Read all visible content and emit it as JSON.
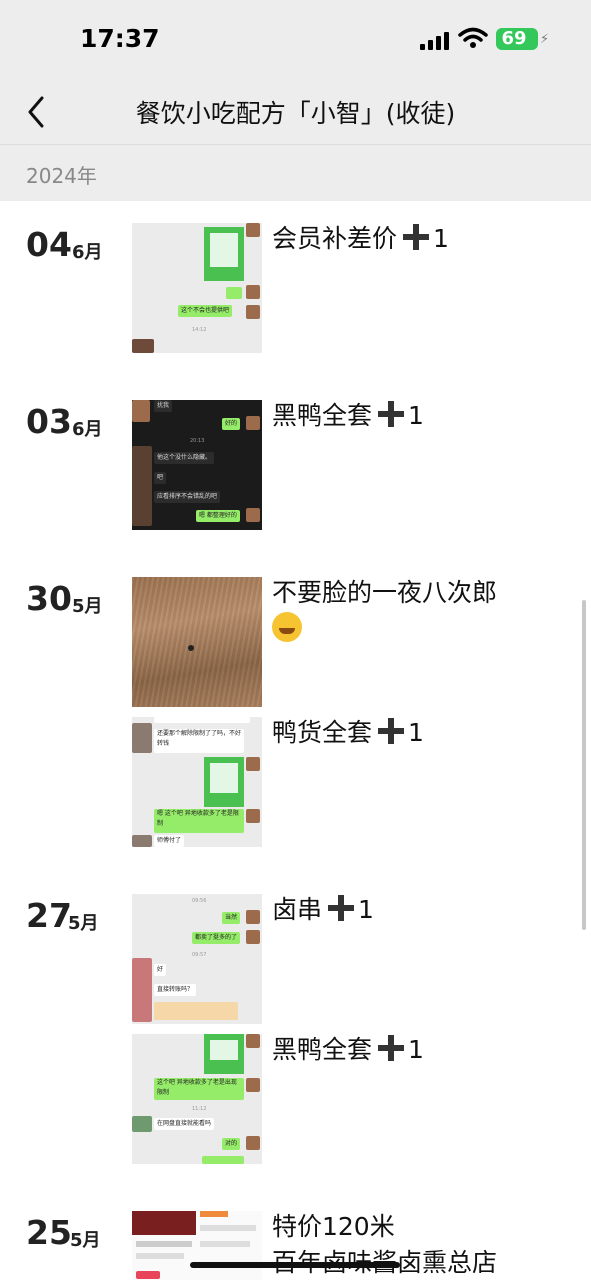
{
  "status": {
    "time": "17:37",
    "battery": "69"
  },
  "nav": {
    "title": "餐饮小吃配方「小智」(收徒)",
    "back_icon": "chevron-left-icon"
  },
  "year": "2024年",
  "days": [
    {
      "day": "04",
      "month": "6月",
      "posts": [
        {
          "text": "会员补差价",
          "plus": true,
          "count": "1",
          "thumb_text": [
            "这个不会也提供吧",
            "14:12"
          ]
        }
      ]
    },
    {
      "day": "03",
      "month": "6月",
      "posts": [
        {
          "text": "黑鸭全套",
          "plus": true,
          "count": "1",
          "thumb_text": [
            "扰我",
            "好的",
            "20:13",
            "他这个没什么隐藏。",
            "吧",
            "应看排序不会错乱的吧",
            "嗯 都整理好的"
          ]
        }
      ]
    },
    {
      "day": "30",
      "month": "5月",
      "posts": [
        {
          "text": "不要脸的一夜八次郎",
          "emoji": "crying-laughing-emoji"
        },
        {
          "text": "鸭货全套",
          "plus": true,
          "count": "1",
          "thumb_text": [
            "还要那个解除限制了了吗，不好转钱",
            "嗯 这个吧 异地收款多了老是限制",
            "师傅付了"
          ]
        }
      ]
    },
    {
      "day": "27",
      "month": "5月",
      "posts": [
        {
          "text": "卤串",
          "plus": true,
          "count": "1",
          "thumb_text": [
            "09:56",
            "当然",
            "都卖了挺多的了",
            "09:57",
            "好",
            "直接转账吗？"
          ]
        },
        {
          "text": "黑鸭全套",
          "plus": true,
          "count": "1",
          "thumb_text": [
            "这个吧 异地收款多了老是出现限制",
            "11:12",
            "在网盘直接就能看吗",
            "对的"
          ]
        }
      ]
    },
    {
      "day": "25",
      "month": "5月",
      "posts": [
        {
          "text": "特价120米",
          "line2": "百年卤味酱卤熏总店"
        }
      ]
    }
  ],
  "colors": {
    "wechat_green": "#95ec69",
    "background": "#ededed",
    "battery": "#34c759"
  }
}
